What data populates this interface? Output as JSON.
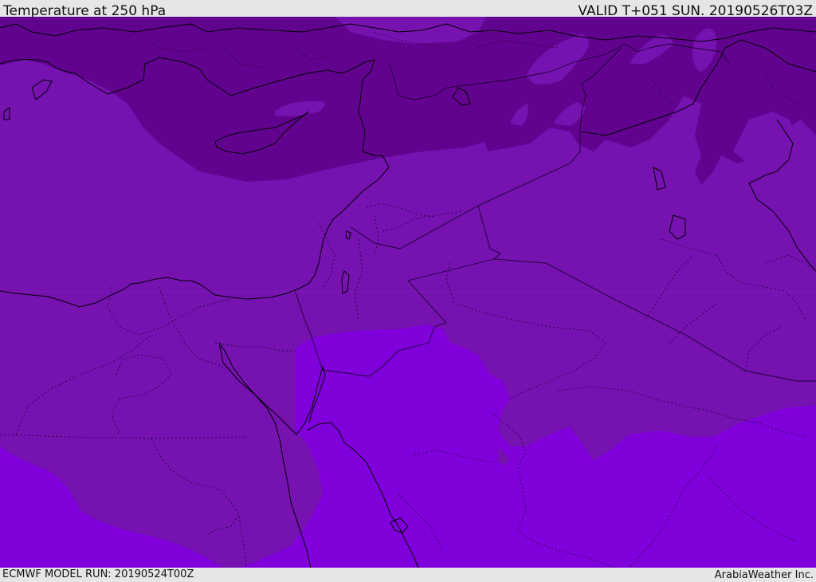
{
  "header": {
    "title": "Temperature at 250 hPa",
    "valid": "VALID T+051 SUN. 20190526T03Z"
  },
  "footer": {
    "model_run": "ECMWF MODEL RUN: 20190524T00Z",
    "credit": "ArabiaWeather Inc."
  },
  "map": {
    "fields": [
      "temperature-250hPa-band-cold",
      "temperature-250hPa-band-mid",
      "temperature-250hPa-band-warm",
      "temperature-250hPa-band-warmest"
    ],
    "colors": {
      "band_cold": "#62038f",
      "band_mid": "#7512b0",
      "band_warm": "#8000dc",
      "band_patch": "#7c18c0",
      "coast": "#000000",
      "border": "#1a0030",
      "labels": "#111111",
      "bar": "#e6e6e6"
    }
  }
}
